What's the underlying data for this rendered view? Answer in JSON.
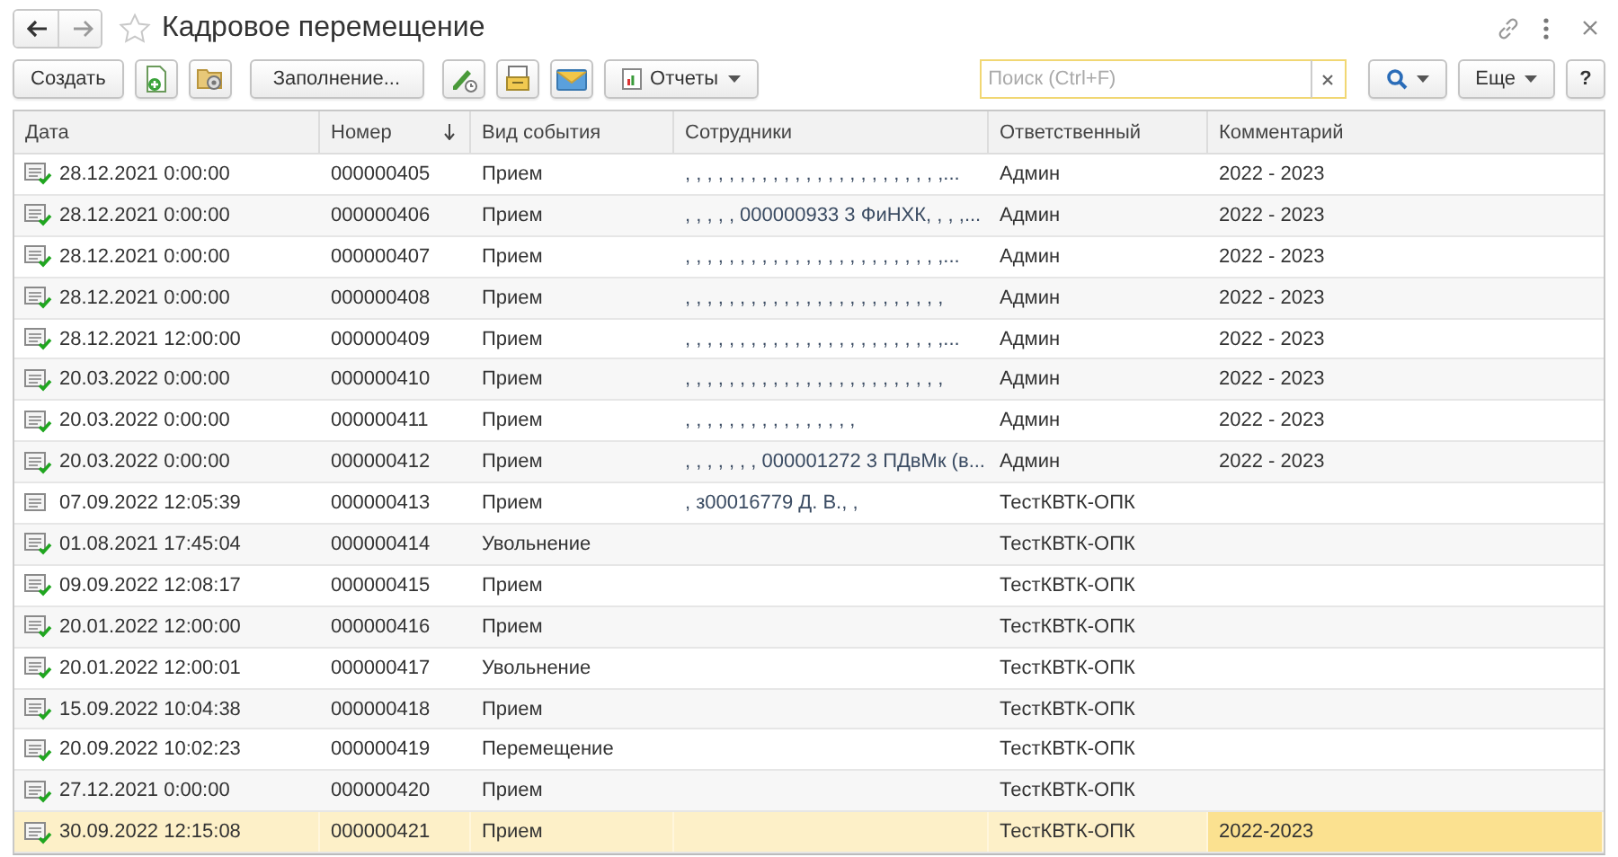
{
  "window": {
    "title": "Кадровое перемещение",
    "favorite": false
  },
  "toolbar": {
    "create": "Создать",
    "fill": "Заполнение...",
    "reports": "Отчеты",
    "search": {
      "placeholder": "Поиск (Ctrl+F)"
    },
    "more": "Еще",
    "help": "?"
  },
  "table": {
    "columns": [
      {
        "label": "Дата"
      },
      {
        "label": "Номер",
        "sorted_descending": true
      },
      {
        "label": "Вид события"
      },
      {
        "label": "Сотрудники"
      },
      {
        "label": "Ответственный"
      },
      {
        "label": "Комментарий"
      }
    ],
    "rows": [
      {
        "posted": true,
        "selected": false,
        "date": "28.12.2021 0:00:00",
        "number": "000000405",
        "event": "Прием",
        "employees": ", , , , , , , , , , , , , , , , , , , , , , , ,...",
        "responsible": "Админ",
        "comment": "2022 - 2023"
      },
      {
        "posted": true,
        "selected": false,
        "date": "28.12.2021 0:00:00",
        "number": "000000406",
        "event": "Прием",
        "employees": ", , , , , 000000933 3 ФиНХК, , , ,...",
        "responsible": "Админ",
        "comment": "2022 - 2023"
      },
      {
        "posted": true,
        "selected": false,
        "date": "28.12.2021 0:00:00",
        "number": "000000407",
        "event": "Прием",
        "employees": ", , , , , , , , , , , , , , , , , , , , , , , ,...",
        "responsible": "Админ",
        "comment": "2022 - 2023"
      },
      {
        "posted": true,
        "selected": false,
        "date": "28.12.2021 0:00:00",
        "number": "000000408",
        "event": "Прием",
        "employees": ", , , , , , , , , , , , , , , , , , , , , , , ,",
        "responsible": "Админ",
        "comment": "2022 - 2023"
      },
      {
        "posted": true,
        "selected": false,
        "date": "28.12.2021 12:00:00",
        "number": "000000409",
        "event": "Прием",
        "employees": ", , , , , , , , , , , , , , , , , , , , , , , ,...",
        "responsible": "Админ",
        "comment": "2022 - 2023"
      },
      {
        "posted": true,
        "selected": false,
        "date": "20.03.2022 0:00:00",
        "number": "000000410",
        "event": "Прием",
        "employees": ", , , , , , , , , , , , , , , , , , , , , , , ,",
        "responsible": "Админ",
        "comment": "2022 - 2023"
      },
      {
        "posted": true,
        "selected": false,
        "date": "20.03.2022 0:00:00",
        "number": "000000411",
        "event": "Прием",
        "employees": ", , , , , , , , , , , , , , , ,",
        "responsible": "Админ",
        "comment": "2022 - 2023"
      },
      {
        "posted": true,
        "selected": false,
        "date": "20.03.2022 0:00:00",
        "number": "000000412",
        "event": "Прием",
        "employees": ", , , , , , , 000001272 3 ПДвМк (в...",
        "responsible": "Админ",
        "comment": "2022 - 2023"
      },
      {
        "posted": false,
        "selected": false,
        "date": "07.09.2022 12:05:39",
        "number": "000000413",
        "event": "Прием",
        "employees": ", з00016779 Д. В., ,",
        "responsible": "ТестКВТК-ОПК"
      },
      {
        "posted": true,
        "selected": false,
        "date": "01.08.2021 17:45:04",
        "number": "000000414",
        "event": "Увольнение",
        "responsible": "ТестКВТК-ОПК"
      },
      {
        "posted": true,
        "selected": false,
        "date": "09.09.2022 12:08:17",
        "number": "000000415",
        "event": "Прием",
        "responsible": "ТестКВТК-ОПК"
      },
      {
        "posted": true,
        "selected": false,
        "date": "20.01.2022 12:00:00",
        "number": "000000416",
        "event": "Прием",
        "responsible": "ТестКВТК-ОПК"
      },
      {
        "posted": true,
        "selected": false,
        "date": "20.01.2022 12:00:01",
        "number": "000000417",
        "event": "Увольнение",
        "responsible": "ТестКВТК-ОПК"
      },
      {
        "posted": true,
        "selected": false,
        "date": "15.09.2022 10:04:38",
        "number": "000000418",
        "event": "Прием",
        "responsible": "ТестКВТК-ОПК"
      },
      {
        "posted": true,
        "selected": false,
        "date": "20.09.2022 10:02:23",
        "number": "000000419",
        "event": "Перемещение",
        "responsible": "ТестКВТК-ОПК"
      },
      {
        "posted": true,
        "selected": false,
        "date": "27.12.2021 0:00:00",
        "number": "000000420",
        "event": "Прием",
        "responsible": "ТестКВТК-ОПК"
      },
      {
        "posted": true,
        "selected": true,
        "comment_focused": true,
        "date": "30.09.2022 12:15:08",
        "number": "000000421",
        "event": "Прием",
        "responsible": "ТестКВТК-ОПК",
        "comment": "2022-2023"
      }
    ]
  }
}
